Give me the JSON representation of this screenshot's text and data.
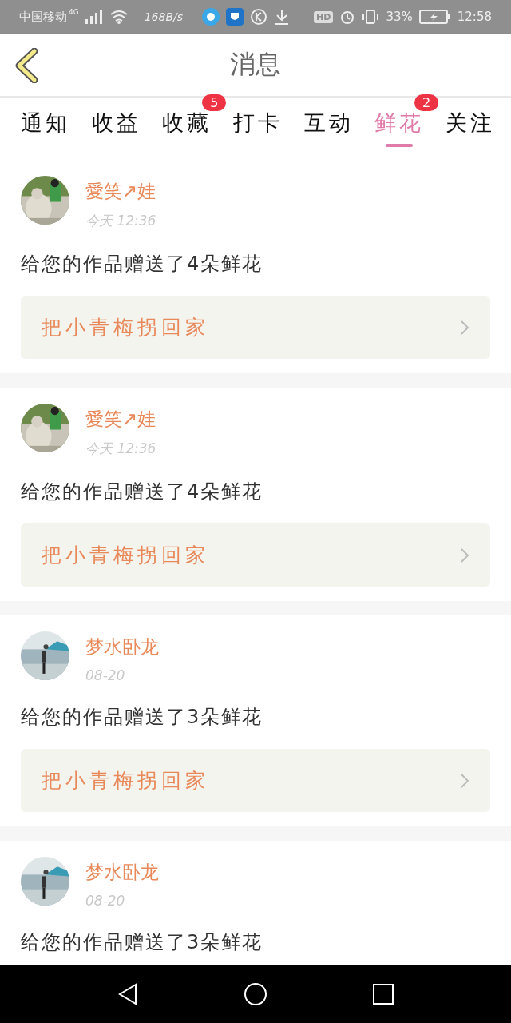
{
  "status_bar": {
    "carrier": "中国移动",
    "network": "4G",
    "speed": "168B/s",
    "hd": "HD",
    "battery": "33%",
    "time": "12:58"
  },
  "header": {
    "title": "消息"
  },
  "tabs": [
    {
      "label": "通知",
      "selected": false
    },
    {
      "label": "收益",
      "selected": false
    },
    {
      "label": "收藏",
      "selected": false,
      "badge": "5"
    },
    {
      "label": "打卡",
      "selected": false
    },
    {
      "label": "互动",
      "selected": false
    },
    {
      "label": "鲜花",
      "selected": true,
      "badge": "2"
    },
    {
      "label": "关注",
      "selected": false
    }
  ],
  "messages": [
    {
      "name": "愛笑↗娃",
      "time": "今天 12:36",
      "text": "给您的作品赠送了4朵鲜花",
      "link": "把小青梅拐回家"
    },
    {
      "name": "愛笑↗娃",
      "time": "今天 12:36",
      "text": "给您的作品赠送了4朵鲜花",
      "link": "把小青梅拐回家"
    },
    {
      "name": "梦水卧龙",
      "time": "08-20",
      "text": "给您的作品赠送了3朵鲜花",
      "link": "把小青梅拐回家"
    },
    {
      "name": "梦水卧龙",
      "time": "08-20",
      "text": "给您的作品赠送了3朵鲜花"
    }
  ]
}
